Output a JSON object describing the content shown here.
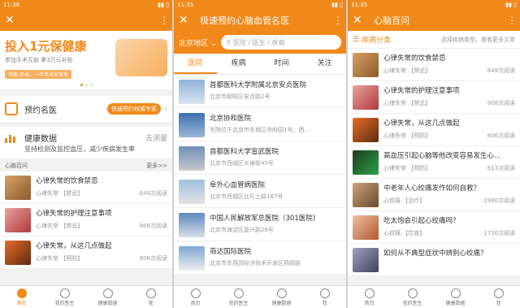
{
  "status_bar": {
    "time_left": "11:36",
    "time_mid": "11:35",
    "time_right": "11:35"
  },
  "screen1": {
    "banner": {
      "headline": "投入1元保健康",
      "sub": "参加手术互助 拿3万元补贴",
      "tag": "可能:手术、一年手术可享受"
    },
    "appointment": {
      "title": "预约名医",
      "button": "快速预约权威专家"
    },
    "health_data": {
      "title": "健康数据",
      "sub": "坚持检测及监控血压，减少疾病发生率",
      "action": "去测量"
    },
    "section": {
      "title": "心脑百问",
      "more": "更多>>"
    },
    "articles": [
      {
        "title": "心律失常的饮食禁忌",
        "cat": "心律失常 【禁忌】",
        "reads": "649次阅读"
      },
      {
        "title": "心律失常的护理注意事项",
        "cat": "心律失常 【禁忌】",
        "reads": "908次阅读"
      },
      {
        "title": "心律失常，从这几点做起",
        "cat": "心律失常 【预防】",
        "reads": "806次阅读"
      }
    ]
  },
  "screen2": {
    "title": "极速预约心脑血管名医",
    "area": "北京地区",
    "search_placeholder": "医院 / 医生 / 疾病",
    "tabs": [
      "医院",
      "疾病",
      "时间",
      "关注"
    ],
    "hospitals": [
      {
        "name": "首都医科大学附属北京安贞医院",
        "addr": "北京市朝阳区安贞路2号"
      },
      {
        "name": "北京协和医院",
        "addr": "东院位于北京市东城区帅府园1号；西..."
      },
      {
        "name": "首都医科大学宣武医院",
        "addr": "北京市西城区长椿街45号"
      },
      {
        "name": "阜外心血管病医院",
        "addr": "北京市西城区北礼士路167号"
      },
      {
        "name": "中国人民解放军总医院（301医院)",
        "addr": "北京市海淀区复兴路28号"
      },
      {
        "name": "燕达国际医院",
        "addr": "北京市东燕郊经济技术开发区燕顺路"
      }
    ]
  },
  "screen3": {
    "title": "心脑百问",
    "filter": "疾病分类",
    "filter_hint": "选择疾病类型，查看更多文章",
    "articles": [
      {
        "title": "心律失常的饮食禁忌",
        "cat": "心律失常 【禁忌】",
        "reads": "649次阅读"
      },
      {
        "title": "心律失常的护理注意事项",
        "cat": "心律失常 【禁忌】",
        "reads": "908次阅读"
      },
      {
        "title": "心律失常，从这几点做起",
        "cat": "心律失常 【预防】",
        "reads": "806次阅读"
      },
      {
        "title": "高血压引起心脑等他改变容易发生心...",
        "cat": "心律失常 【预防】",
        "reads": "613次阅读"
      },
      {
        "title": "中老年人心绞痛发作如何自救？",
        "cat": "心绞痛 【治疗】",
        "reads": "1980次阅读"
      },
      {
        "title": "吃太饱会引起心绞痛吗？",
        "cat": "心绞痛 【饮食】",
        "reads": "1750次阅读"
      },
      {
        "title": "如何从不典型症状中辨别心绞痛？",
        "cat": "",
        "reads": ""
      }
    ]
  },
  "nav": [
    "首页",
    "我的医生",
    "健康数据",
    "我"
  ]
}
